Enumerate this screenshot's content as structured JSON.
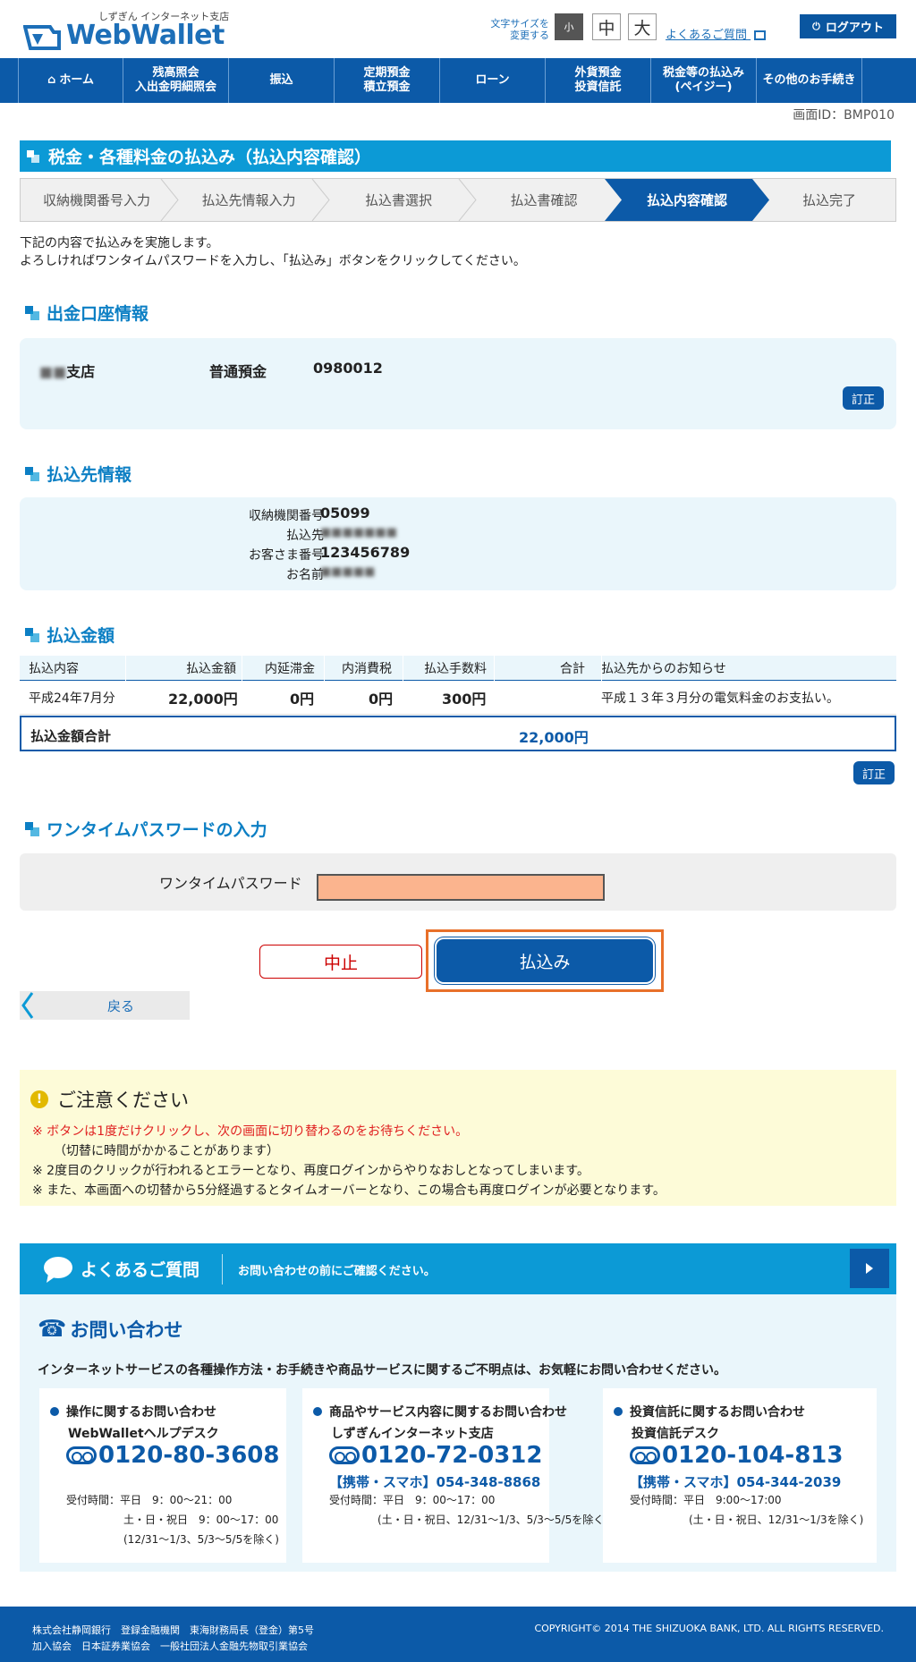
{
  "header": {
    "logo_sub": "しずぎん インターネット支店",
    "logo_text": "WebWallet",
    "fontsize_label_1": "文字サイズを",
    "fontsize_label_2": "変更する",
    "fontsize_small": "小",
    "fontsize_medium": "中",
    "fontsize_large": "大",
    "faq_link": "よくあるご質問",
    "logout": "ログアウト"
  },
  "nav": {
    "items": [
      {
        "label": "ホーム"
      },
      {
        "label": "残高照会\n入出金明細照会"
      },
      {
        "label": "振込"
      },
      {
        "label": "定期預金\n積立預金"
      },
      {
        "label": "ローン"
      },
      {
        "label": "外貨預金\n投資信託"
      },
      {
        "label": "税金等の払込み\n(ペイジー)"
      },
      {
        "label": "その他のお手続き"
      }
    ]
  },
  "screen_id": "画面ID：BMP010",
  "page_title": "税金・各種料金の払込み（払込内容確認）",
  "steps": [
    "収納機関番号入力",
    "払込先情報入力",
    "払込書選択",
    "払込書確認",
    "払込内容確認",
    "払込完了"
  ],
  "intro": {
    "line1": "下記の内容で払込みを実施します。",
    "line2": "よろしければワンタイムパスワードを入力し、「払込み」ボタンをクリックしてください。"
  },
  "account": {
    "heading": "出金口座情報",
    "branch_suffix": "支店",
    "type": "普通預金",
    "number": "0980012",
    "edit": "訂正"
  },
  "payee": {
    "heading": "払込先情報",
    "rows": [
      {
        "label": "収納機関番号",
        "value": "05099"
      },
      {
        "label": "払込先",
        "value": ""
      },
      {
        "label": "お客さま番号",
        "value": "123456789"
      },
      {
        "label": "お名前",
        "value": ""
      }
    ]
  },
  "amount": {
    "heading": "払込金額",
    "columns": [
      "払込内容",
      "払込金額",
      "内延滞金",
      "内消費税",
      "払込手数料",
      "合計",
      "払込先からのお知らせ"
    ],
    "row": {
      "content": "平成24年7月分",
      "amount": "22,000円",
      "late_fee": "0円",
      "tax": "0円",
      "fee": "300円",
      "total": "",
      "notice": "平成１３年３月分の電気料金のお支払い。"
    },
    "total_label": "払込金額合計",
    "total_value": "22,000円",
    "edit": "訂正"
  },
  "otp": {
    "heading": "ワンタイムパスワードの入力",
    "label": "ワンタイムパスワード",
    "value": ""
  },
  "buttons": {
    "cancel": "中止",
    "pay": "払込み",
    "back": "戻る"
  },
  "notice": {
    "title": "ご注意ください",
    "line1": "※ ボタンは1度だけクリックし、次の画面に切り替わるのをお待ちください。",
    "line2": "（切替に時間がかかることがあります）",
    "line3": "※ 2度目のクリックが行われるとエラーとなり、再度ログインからやりなおしとなってしまいます。",
    "line4": "※ また、本画面への切替から5分経過するとタイムオーバーとなり、この場合も再度ログインが必要となります。"
  },
  "faq_bar": {
    "title": "よくあるご質問",
    "sub": "お問い合わせの前にご確認ください。"
  },
  "contact": {
    "title": "お問い合わせ",
    "lead": "インターネットサービスの各種操作方法・お手続きや商品サービスに関するご不明点は、お気軽にお問い合わせください。",
    "cards": [
      {
        "heading": "操作に関するお問い合わせ",
        "desk": "WebWalletヘルプデスク",
        "tel": "0120-80-3608",
        "mobile": "",
        "hours1": "受付時間：平日　9：00～21：00",
        "hours2": "土・日・祝日　9：00～17：00",
        "hours3": "(12/31～1/3、5/3～5/5を除く)"
      },
      {
        "heading": "商品やサービス内容に関するお問い合わせ",
        "desk": "しずぎんインターネット支店",
        "tel": "0120-72-0312",
        "mobile": "【携帯・スマホ】054-348-8868",
        "hours1": "受付時間：平日　9：00～17：00",
        "hours2": "(土・日・祝日、12/31～1/3、5/3～5/5を除く)",
        "hours3": ""
      },
      {
        "heading": "投資信託に関するお問い合わせ",
        "desk": "投資信託デスク",
        "tel": "0120-104-813",
        "mobile": "【携帯・スマホ】054-344-2039",
        "hours1": "受付時間：平日　9:00～17:00",
        "hours2": "(土・日・祝日、12/31～1/3を除く)",
        "hours3": ""
      }
    ]
  },
  "footer": {
    "line1": "株式会社静岡銀行　登録金融機関　東海財務局長（登金）第5号",
    "line2": "加入協会　日本証券業協会　一般社団法人金融先物取引業協会",
    "copyright": "COPYRIGHT© 2014 THE SHIZUOKA BANK, LTD. ALL RIGHTS RESERVED."
  }
}
